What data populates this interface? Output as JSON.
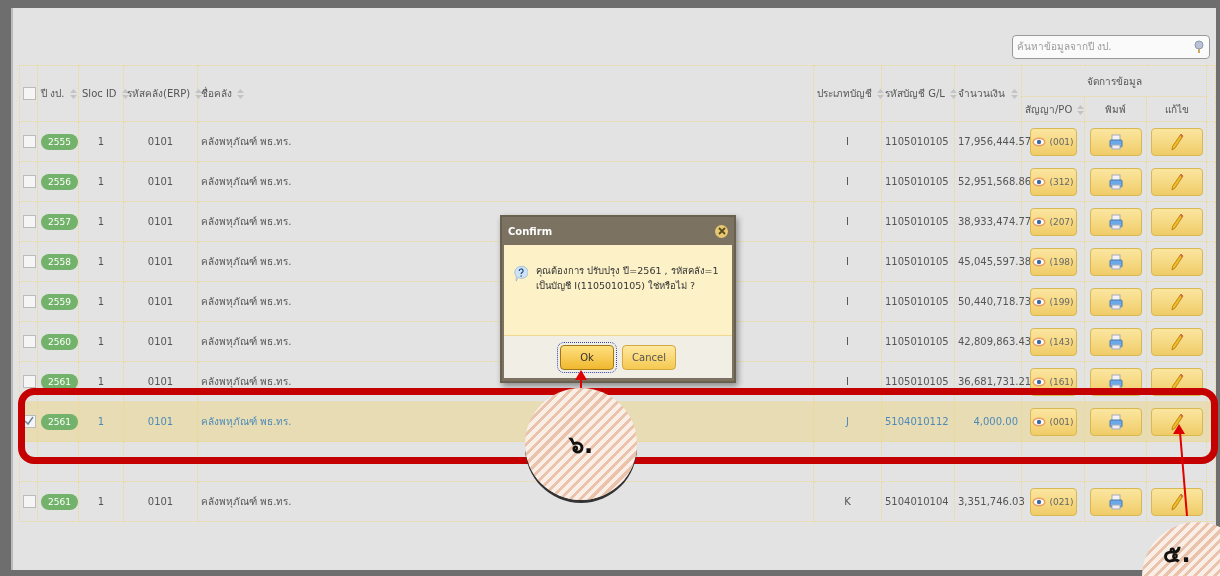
{
  "search": {
    "placeholder": "ค้นหาข้อมูลจากปี งป."
  },
  "table": {
    "columns": [
      {
        "label": "ปี งป.",
        "sortable": true
      },
      {
        "label": "Sloc ID",
        "sortable": true
      },
      {
        "label": "รหัสคลัง(ERP)",
        "sortable": true
      },
      {
        "label": "ชื่อคลัง",
        "sortable": true
      },
      {
        "label": "ประเภทบัญชี",
        "sortable": true
      },
      {
        "label": "รหัสบัญชี G/L",
        "sortable": true
      },
      {
        "label": "จำนวนเงิน",
        "sortable": true
      }
    ],
    "select_all": {
      "checked": false
    },
    "group_header": "จัดการข้อมูล",
    "subcolumns": [
      {
        "label": "สัญญา/PO",
        "sortable": true
      },
      {
        "label": "พิมพ์",
        "sortable": false
      },
      {
        "label": "แก้ไข",
        "sortable": false
      }
    ],
    "rows": [
      {
        "year": "2555",
        "sloc": "1",
        "erp": "0101",
        "name": "คลังพหุภัณฑ์ พธ.ทร.",
        "type": "I",
        "gl": "1105010105",
        "amount": "17,956,444.57",
        "contracts": "(001)",
        "selected": false
      },
      {
        "year": "2556",
        "sloc": "1",
        "erp": "0101",
        "name": "คลังพหุภัณฑ์ พธ.ทร.",
        "type": "I",
        "gl": "1105010105",
        "amount": "52,951,568.86",
        "contracts": "(312)",
        "selected": false
      },
      {
        "year": "2557",
        "sloc": "1",
        "erp": "0101",
        "name": "คลังพหุภัณฑ์ พธ.ทร.",
        "type": "I",
        "gl": "1105010105",
        "amount": "38,933,474.77",
        "contracts": "(207)",
        "selected": false
      },
      {
        "year": "2558",
        "sloc": "1",
        "erp": "0101",
        "name": "คลังพหุภัณฑ์ พธ.ทร.",
        "type": "I",
        "gl": "1105010105",
        "amount": "45,045,597.38",
        "contracts": "(198)",
        "selected": false
      },
      {
        "year": "2559",
        "sloc": "1",
        "erp": "0101",
        "name": "คลังพหุภัณฑ์ พธ.ทร.",
        "type": "I",
        "gl": "1105010105",
        "amount": "50,440,718.73",
        "contracts": "(199)",
        "selected": false
      },
      {
        "year": "2560",
        "sloc": "1",
        "erp": "0101",
        "name": "คลังพหุภัณฑ์ พธ.ทร.",
        "type": "I",
        "gl": "1105010105",
        "amount": "42,809,863.43",
        "contracts": "(143)",
        "selected": false
      },
      {
        "year": "2561",
        "sloc": "1",
        "erp": "0101",
        "name": "คลังพหุภัณฑ์ พธ.ทร.",
        "type": "I",
        "gl": "1105010105",
        "amount": "36,681,731.21",
        "contracts": "(161)",
        "selected": false
      },
      {
        "year": "2561",
        "sloc": "1",
        "erp": "0101",
        "name": "คลังพหุภัณฑ์ พธ.ทร.",
        "type": "J",
        "gl": "5104010112",
        "amount": "4,000.00",
        "contracts": "(001)",
        "selected": true
      },
      {
        "kind": "covered"
      },
      {
        "year": "2561",
        "sloc": "1",
        "erp": "0101",
        "name": "คลังพหุภัณฑ์ พธ.ทร.",
        "type": "K",
        "gl": "5104010104",
        "amount": "3,351,746.03",
        "contracts": "(021)",
        "selected": false
      }
    ]
  },
  "dialog": {
    "title": "Confirm",
    "message": "คุณต้องการ ปรับปรุง ปี=2561 , รหัสคลัง=1 เป็นบัญชี I(1105010105) ใช่หรือไม่ ?",
    "buttons": [
      {
        "label": "Ok",
        "focused": true
      },
      {
        "label": "Cancel",
        "focused": false
      }
    ]
  },
  "annotations": [
    {
      "label": "๖."
    },
    {
      "label": "๕."
    }
  ]
}
